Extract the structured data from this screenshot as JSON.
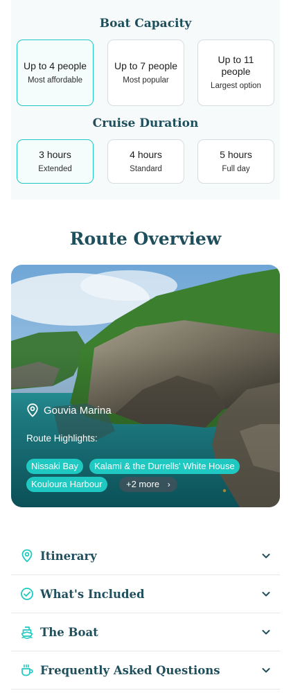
{
  "capacity": {
    "title": "Boat Capacity",
    "options": [
      {
        "main": "Up to 4 people",
        "sub": "Most affordable",
        "selected": true
      },
      {
        "main": "Up to 7 people",
        "sub": "Most popular",
        "selected": false
      },
      {
        "main": "Up to 11 people",
        "sub": "Largest option",
        "selected": false
      }
    ]
  },
  "duration": {
    "title": "Cruise Duration",
    "options": [
      {
        "main": "3 hours",
        "sub": "Extended",
        "selected": true
      },
      {
        "main": "4 hours",
        "sub": "Standard",
        "selected": false
      },
      {
        "main": "5 hours",
        "sub": "Full day",
        "selected": false
      }
    ]
  },
  "route": {
    "title": "Route Overview",
    "start_location": "Gouvia Marina",
    "highlights_label": "Route Highlights:",
    "highlights": [
      "Nissaki Bay",
      "Kalami & the Durrells' White House",
      "Kouloura Harbour"
    ],
    "more_label": "+2 more",
    "more_icon": "chevron-right-icon"
  },
  "accordion": [
    {
      "label": "Itinerary",
      "icon": "map-pin-icon"
    },
    {
      "label": "What's Included",
      "icon": "check-circle-icon"
    },
    {
      "label": "The Boat",
      "icon": "boat-icon"
    },
    {
      "label": "Frequently Asked Questions",
      "icon": "coffee-cup-icon"
    }
  ],
  "colors": {
    "accent": "#1fc8c0",
    "heading": "#1f4f5c"
  }
}
